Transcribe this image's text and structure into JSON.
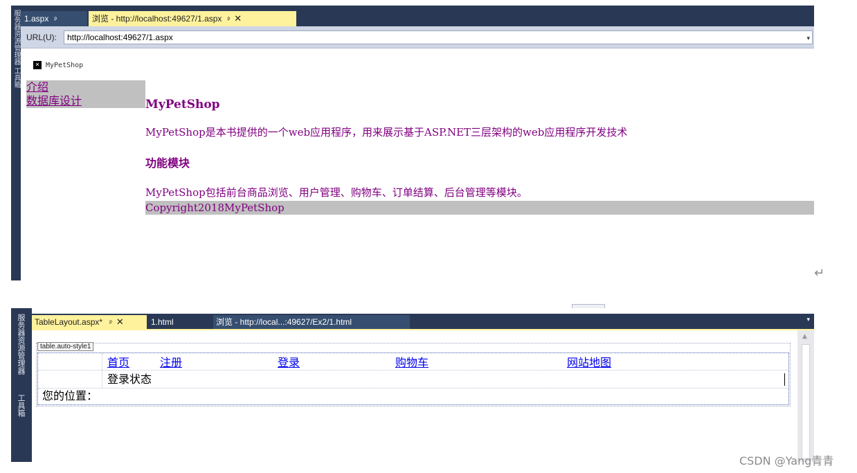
{
  "top": {
    "side_text": "服务器资源管理器 工具箱",
    "tabs": [
      {
        "label": "1.aspx",
        "pin": "ᵖ"
      },
      {
        "label": "浏览 - http://localhost:49627/1.aspx",
        "pin": "ᵖ",
        "close": "✕"
      }
    ],
    "url": {
      "label": "URL(U):",
      "value": "http://localhost:49627/1.aspx",
      "dropdown": "▾"
    },
    "page": {
      "broken_image_alt": "MyPetShop",
      "nav": [
        "介绍",
        "数据库设计"
      ],
      "heading1": "MyPetShop",
      "para1": "MyPetShop是本书提供的一个web应用程序，用来展示基于ASP.NET三层架构的web应用程序开发技术",
      "heading2": "功能模块",
      "para2": "MyPetShop包括前台商品浏览、用户管理、购物车、订单结算、后台管理等模块。",
      "footer": "Copyright2018MyPetShop"
    },
    "return_mark": "↵"
  },
  "bottom": {
    "side_text_1": "服务器资源管理器",
    "side_text_2": "工具箱",
    "tabs": [
      {
        "label": "TableLayout.aspx*",
        "pin": "ᵖ",
        "close": "✕"
      },
      {
        "label": "1.html"
      },
      {
        "label": "浏览 - http://local...:49627/Ex2/1.html"
      }
    ],
    "dropdown": "▾",
    "table_tag": "table.auto-style1",
    "nav_links": [
      "首页",
      "注册",
      "登录",
      "购物车",
      "网站地图"
    ],
    "login_status": "登录状态",
    "location": "您的位置："
  },
  "watermark": "CSDN @Yang青青"
}
